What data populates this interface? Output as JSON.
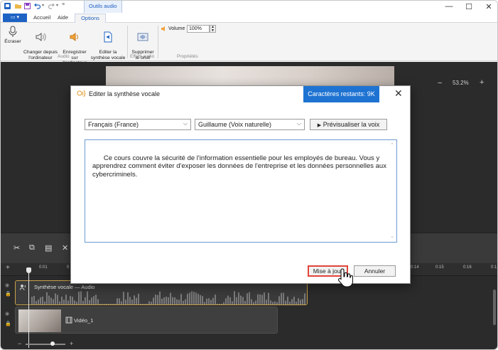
{
  "window": {
    "context_tab": "Outils audio",
    "controls": {
      "minimize": "—",
      "maximize": "☐",
      "close": "✕"
    }
  },
  "ribbon_tabs": {
    "file_menu": "▾",
    "tabs": [
      "Accueil",
      "Aide",
      "Options"
    ],
    "active": "Options"
  },
  "ribbon": {
    "buttons": [
      {
        "label": "Écraser",
        "icon": "microphone-icon"
      },
      {
        "label": "Changer depuis\nl'ordinateur",
        "icon": "audio-replace-icon"
      },
      {
        "label": "Enregistrer sur\nl'ordinateur",
        "icon": "audio-save-icon"
      },
      {
        "label": "Editer la\nsynthèse vocale",
        "icon": "text-to-speech-icon"
      },
      {
        "label": "Supprimer\nle bruit",
        "icon": "noise-removal-icon"
      }
    ],
    "groups": [
      "Audio",
      "Effets audio",
      "Propriétés"
    ],
    "volume_label": "Volume",
    "volume_value": "100%"
  },
  "editor": {
    "zoom": "53.2%",
    "zoom_minus": "−",
    "zoom_plus": "+"
  },
  "timeline": {
    "ruler_labels": [
      "0:01",
      "0",
      "0:14",
      "0:15",
      "0:16",
      "0:1"
    ],
    "audio_track_label": "Synthèse vocale — Audio",
    "video_track_label": "Vidéo_1"
  },
  "dialog": {
    "title": "Editer la synthèse vocale",
    "chars_remaining": "Caractères restants: 9K",
    "close": "✕",
    "language": "Français (France)",
    "voice": "Guillaume (Voix naturelle)",
    "preview_button": "Prévisualiser la voix",
    "text": "Ce cours couvre la sécurité de l'information essentielle pour les employés de bureau. Vous y apprendrez comment éviter d'exposer les données de l'entreprise et les données personnelles aux cybercriminels.",
    "update_button": "Mise à jour",
    "cancel_button": "Annuler"
  },
  "colors": {
    "accent": "#1e73d2",
    "highlight": "#e0453a",
    "timeline_bg": "#2b2b2b",
    "audio_clip_border": "#c9a04a"
  }
}
